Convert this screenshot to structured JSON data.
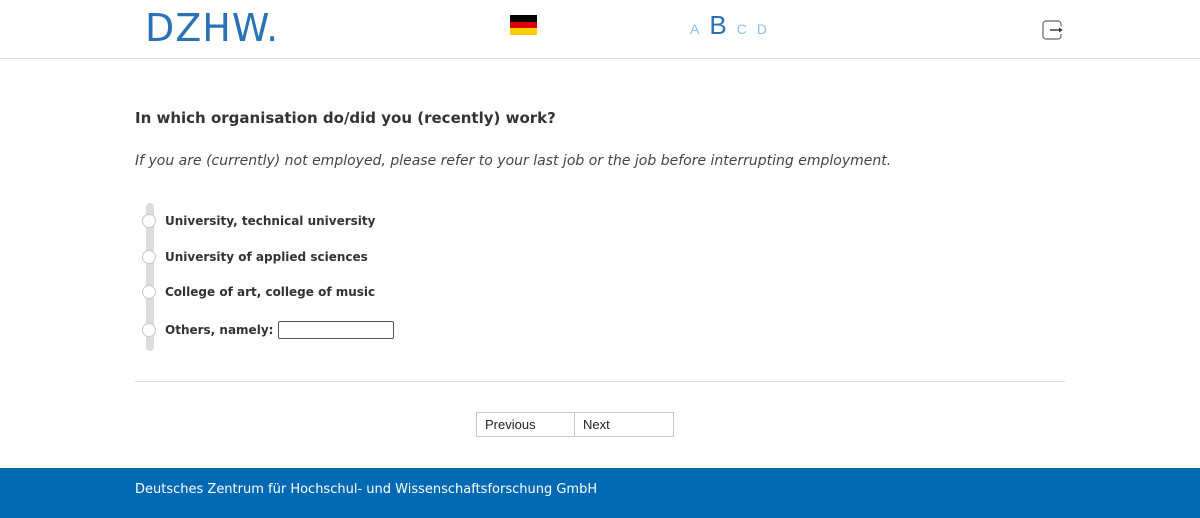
{
  "header": {
    "logo_text": "DZHW.",
    "flag": {
      "icon": "german-flag-icon",
      "colors": [
        "#000000",
        "#dd0000",
        "#ffce00"
      ]
    },
    "language_switch": [
      "A",
      "B",
      "C",
      "D"
    ],
    "active_language_switch": "B",
    "logout_icon": "logout-icon"
  },
  "question": {
    "title": "In which organisation do/did you (recently) work?",
    "instruction": "If you are (currently) not employed, please refer to your last job or the job before interrupting employment.",
    "options": [
      {
        "label": "University, technical university"
      },
      {
        "label": "University of applied sciences"
      },
      {
        "label": "College of art, college of music"
      },
      {
        "label": "Others, namely:"
      }
    ],
    "other_input_value": ""
  },
  "navigation": {
    "previous_label": "Previous",
    "next_label": "Next"
  },
  "footer": {
    "text": "Deutsches Zentrum für Hochschul- und Wissenschaftsforschung GmbH"
  },
  "colors": {
    "brand": "#2a72b5",
    "footer_bg": "#0069b4",
    "inactive_letter": "#8fc1e3"
  }
}
